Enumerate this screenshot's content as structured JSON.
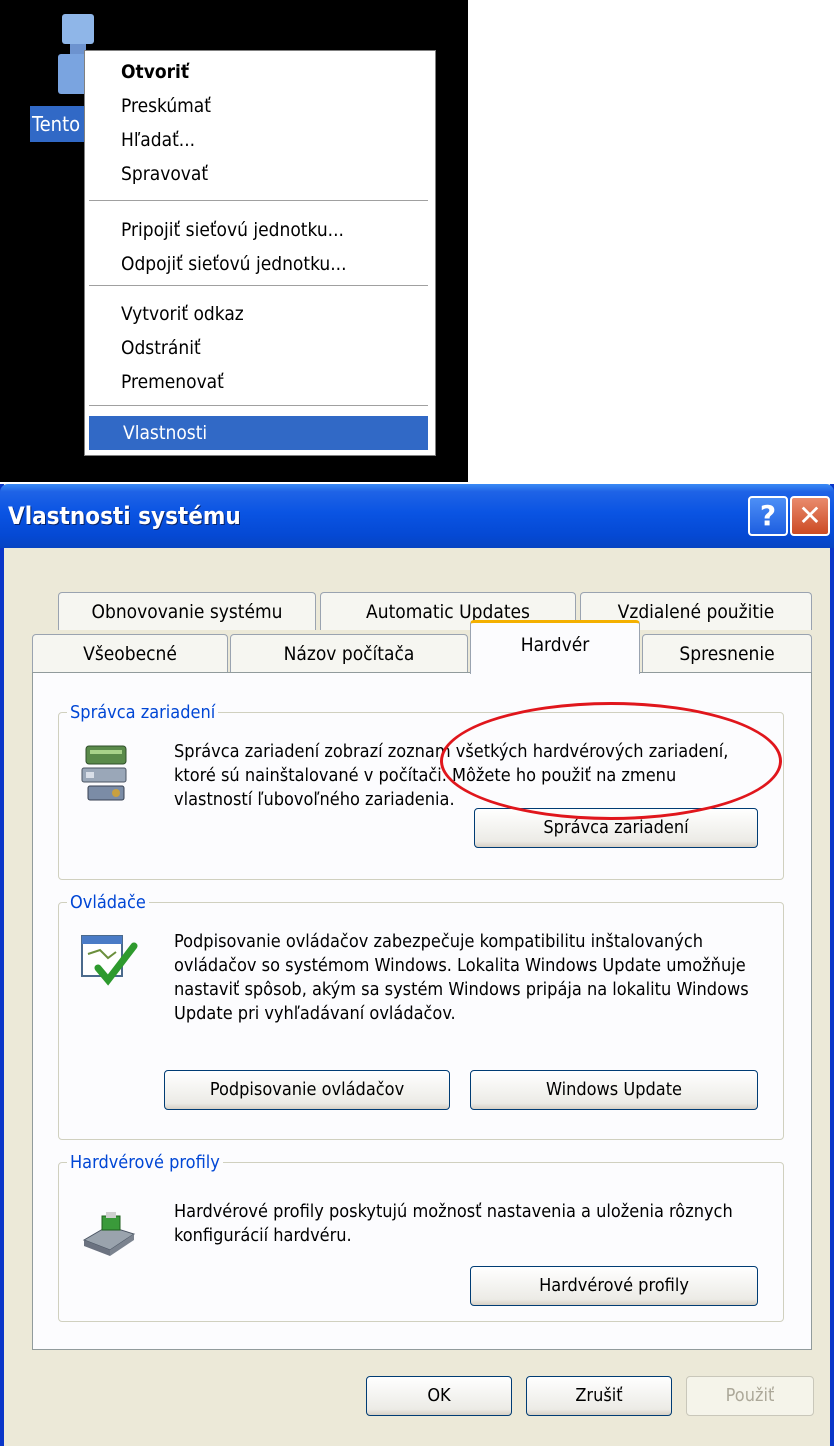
{
  "desktop": {
    "icon_label": "Tento počítač",
    "context_menu": {
      "groups": [
        [
          "Otvoriť",
          "Preskúmať",
          "Hľadať...",
          "Spravovať"
        ],
        [
          "Pripojiť sieťovú jednotku...",
          "Odpojiť sieťovú jednotku..."
        ],
        [
          "Vytvoriť odkaz",
          "Odstrániť",
          "Premenovať"
        ],
        [
          "Vlastnosti"
        ]
      ],
      "default_item": "Otvoriť",
      "selected_item": "Vlastnosti"
    }
  },
  "dialog": {
    "title": "Vlastnosti systému",
    "help_label": "?",
    "close_label": "✕",
    "tabs_row1": [
      "Obnovovanie systému",
      "Automatic Updates",
      "Vzdialené použitie"
    ],
    "tabs_row2": [
      "Všeobecné",
      "Názov počítača",
      "Hardvér",
      "Spresnenie"
    ],
    "active_tab": "Hardvér",
    "groups": {
      "device_manager": {
        "legend": "Správca zariadení",
        "description": "Správca zariadení zobrazí zoznam všetkých hardvérových zariadení, ktoré sú nainštalované v počítači. Môžete ho použiť na zmenu vlastností ľubovoľného zariadenia.",
        "button": "Správca zariadení",
        "icon": "device-manager-icon"
      },
      "drivers": {
        "legend": "Ovládače",
        "description": "Podpisovanie ovládačov zabezpečuje kompatibilitu inštalovaných ovládačov so systémom Windows. Lokalita Windows Update umožňuje nastaviť spôsob, akým sa systém Windows pripája na lokalitu Windows Update pri vyhľadávaní ovládačov.",
        "button_signing": "Podpisovanie ovládačov",
        "button_update": "Windows Update",
        "icon": "driver-signing-icon"
      },
      "hardware_profiles": {
        "legend": "Hardvérové profily",
        "description": "Hardvérové profily poskytujú možnosť nastavenia a uloženia rôznych konfigurácií hardvéru.",
        "button": "Hardvérové profily",
        "icon": "hardware-profiles-icon"
      }
    },
    "buttons": {
      "ok": "OK",
      "cancel": "Zrušiť",
      "apply": "Použiť"
    },
    "highlight": "red ellipse around Správca zariadení button"
  },
  "colors": {
    "title_bar": "#0a54e3",
    "dialog_bg": "#ece9d8",
    "menu_highlight": "#3169c6",
    "group_legend": "#0046d5",
    "annotation_ring": "#e0161c",
    "active_tab_accent": "#f4b000"
  }
}
